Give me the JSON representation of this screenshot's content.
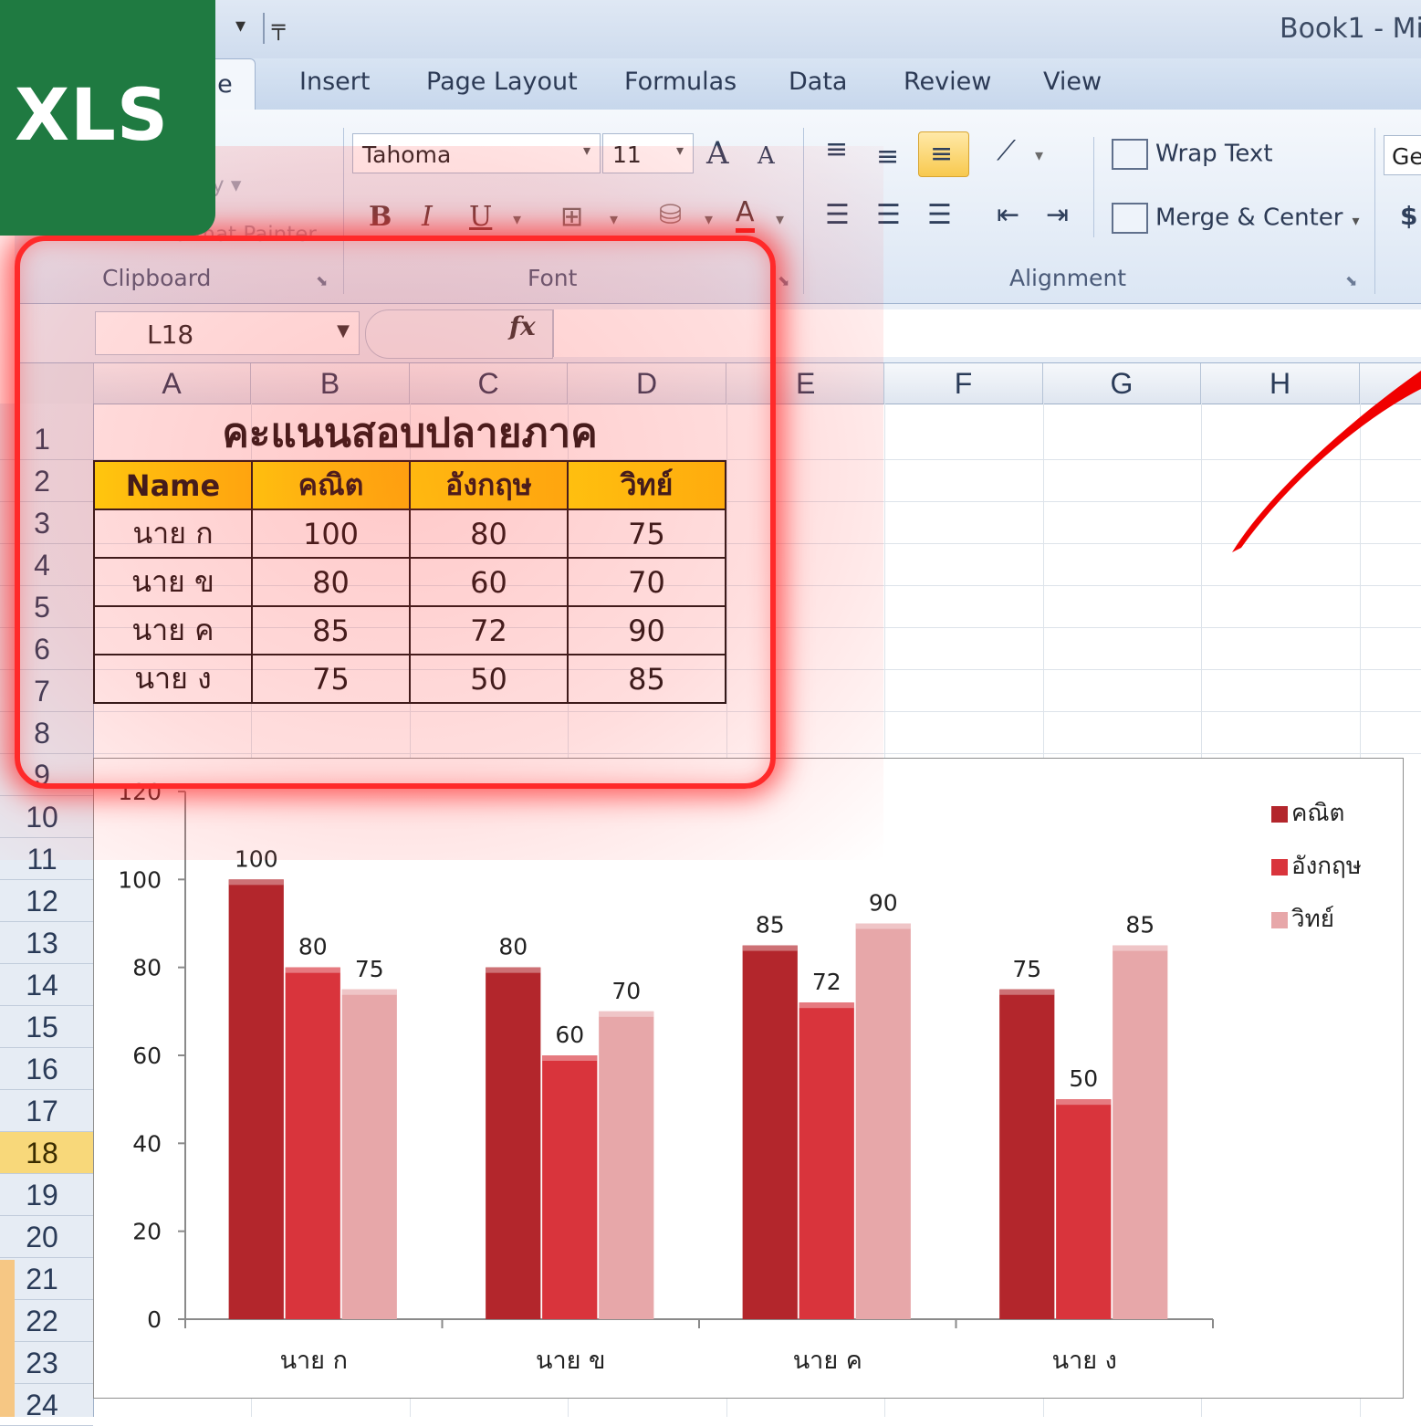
{
  "badge": {
    "label": "XLS"
  },
  "title_bar": {
    "window_title": "Book1 - Mi",
    "qat_dropdown": "▾",
    "qat_customize": "╤"
  },
  "tabs": [
    {
      "label": "ne",
      "active": true
    },
    {
      "label": "Insert"
    },
    {
      "label": "Page Layout"
    },
    {
      "label": "Formulas"
    },
    {
      "label": "Data"
    },
    {
      "label": "Review"
    },
    {
      "label": "View"
    }
  ],
  "ribbon": {
    "clipboard": {
      "label": "Clipboard",
      "faded_item1": "y ▾",
      "faded_item2": "Format Painter"
    },
    "font": {
      "label": "Font",
      "font_name": "Tahoma",
      "font_size": "11",
      "grow": "A",
      "shrink": "A",
      "bold": "B",
      "italic": "I",
      "underline": "U",
      "font_color": "A"
    },
    "alignment": {
      "label": "Alignment",
      "wrap_text": "Wrap Text",
      "merge_center": "Merge & Center"
    },
    "number": {
      "format_partial": "Ge",
      "currency": "$"
    },
    "launcher": "⬊"
  },
  "formula_bar": {
    "name_box": "L18",
    "fx": "fx",
    "formula": ""
  },
  "columns": [
    "A",
    "B",
    "C",
    "D",
    "E",
    "F",
    "G",
    "H"
  ],
  "rows": [
    "1",
    "2",
    "3",
    "4",
    "5",
    "6",
    "7",
    "8",
    "9",
    "10",
    "11",
    "12",
    "13",
    "14",
    "15",
    "16",
    "17",
    "18",
    "19",
    "20",
    "21",
    "22",
    "23",
    "24"
  ],
  "selected_row": "18",
  "sheet": {
    "title": "คะแนนสอบปลายภาค",
    "headers": [
      "Name",
      "คณิต",
      "อังกฤษ",
      "วิทย์"
    ],
    "rows": [
      [
        "นาย ก",
        "100",
        "80",
        "75"
      ],
      [
        "นาย ข",
        "80",
        "60",
        "70"
      ],
      [
        "นาย ค",
        "85",
        "72",
        "90"
      ],
      [
        "นาย ง",
        "75",
        "50",
        "85"
      ]
    ]
  },
  "chart_data": {
    "type": "bar",
    "categories": [
      "นาย ก",
      "นาย ข",
      "นาย ค",
      "นาย ง"
    ],
    "series": [
      {
        "name": "คณิต",
        "values": [
          100,
          80,
          85,
          75
        ],
        "color": "#b3262c"
      },
      {
        "name": "อังกฤษ",
        "values": [
          80,
          60,
          72,
          50
        ],
        "color": "#d9343c"
      },
      {
        "name": "วิทย์",
        "values": [
          75,
          70,
          90,
          85
        ],
        "color": "#e7a7a9"
      }
    ],
    "yticks": [
      "0",
      "20",
      "40",
      "60",
      "80",
      "100",
      "120"
    ],
    "ylim": [
      0,
      120
    ],
    "legend_position": "right",
    "data_labels": true,
    "grid": false
  }
}
